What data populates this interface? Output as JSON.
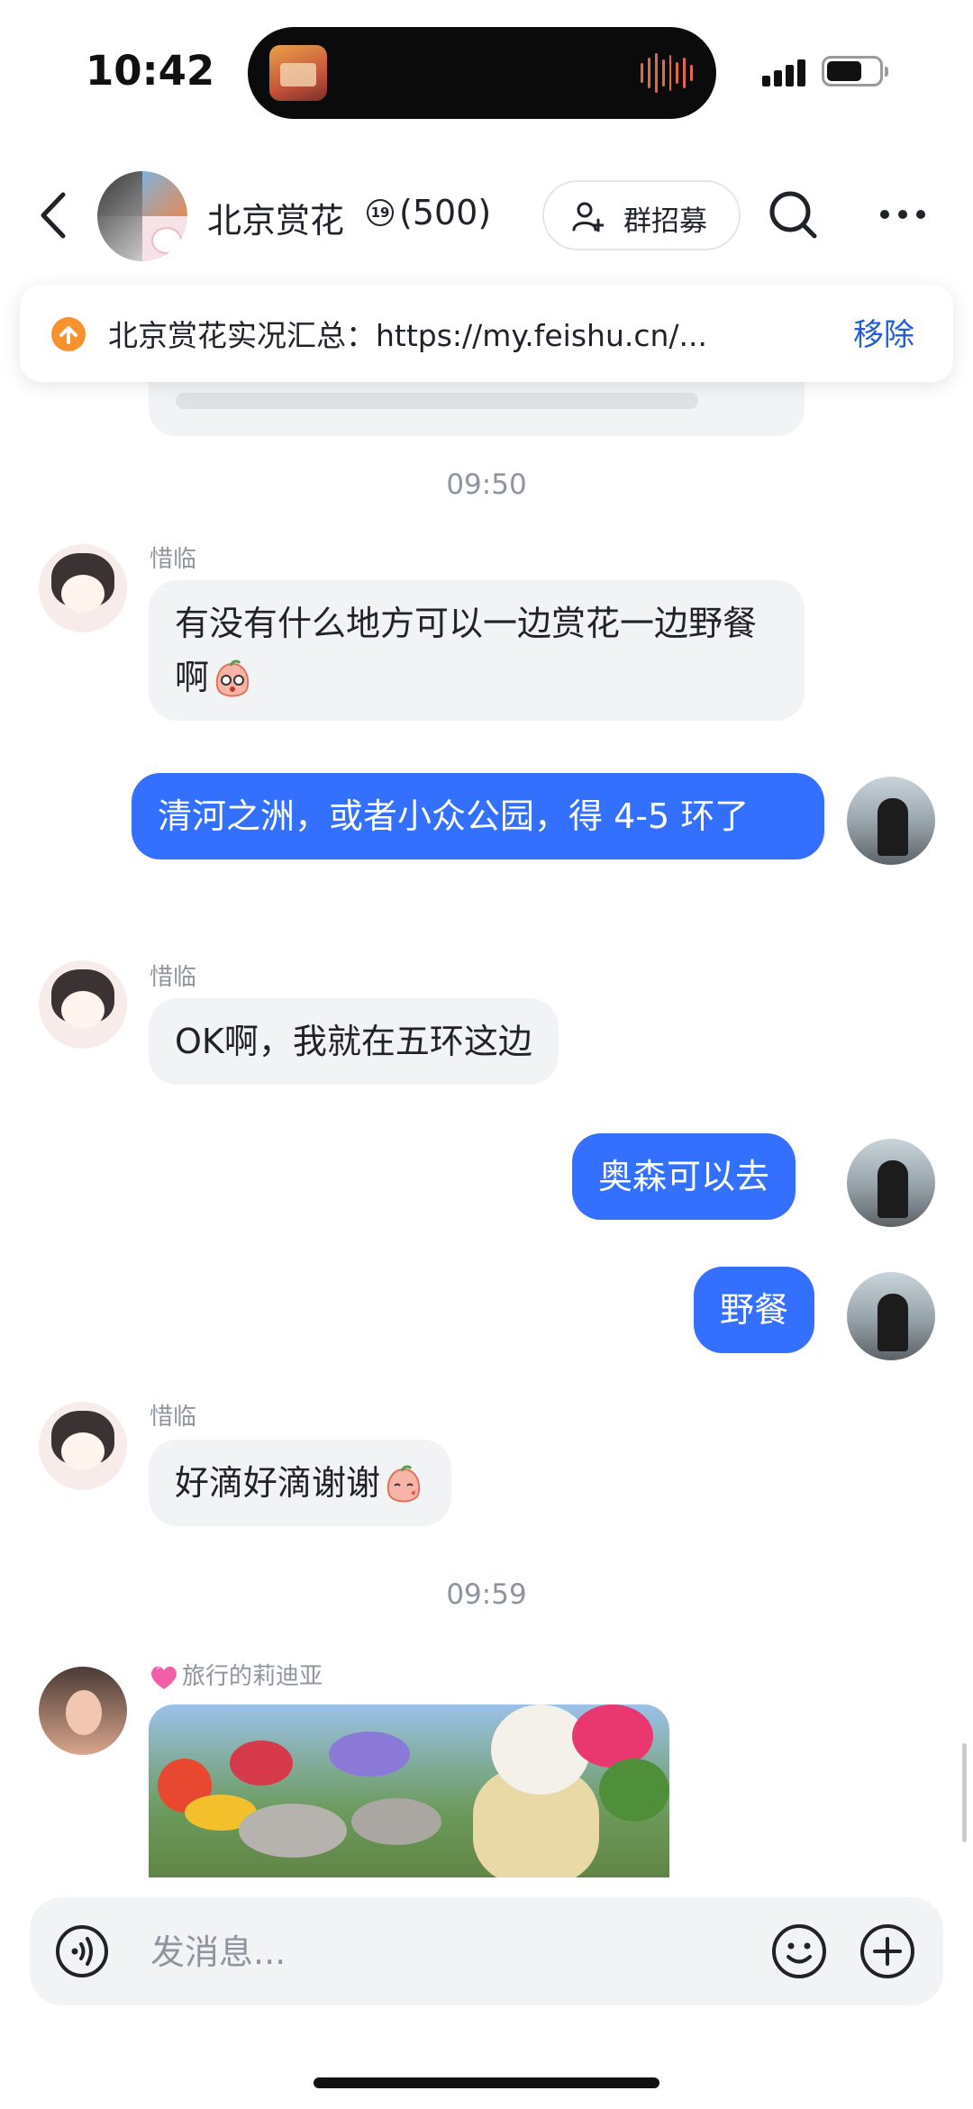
{
  "status_bar": {
    "time": "10:42"
  },
  "header": {
    "group_name": "北京赏花",
    "badge": "19",
    "member_count": "(500)",
    "recruit_label": "群招募"
  },
  "pinned": {
    "text": "北京赏花实况汇总：https://my.feishu.cn/...",
    "action": "移除"
  },
  "messages": {
    "time_1": "09:50",
    "m1_sender": "惜临",
    "m1_text": "有没有什么地方可以一边赏花一边野餐啊",
    "m2_text": "清河之洲，或者小众公园，得 4-5 环了",
    "m3_sender": "惜临",
    "m3_text": "OK啊，我就在五环这边",
    "m4_text": "奥森可以去",
    "m5_text": "野餐",
    "m6_sender": "惜临",
    "m6_text": "好滴好滴谢谢",
    "time_2": "09:59",
    "m7_sender": "旅行的莉迪亚"
  },
  "composer": {
    "placeholder": "发消息..."
  },
  "colors": {
    "accent": "#3370ff",
    "bubble_in": "#f2f3f5",
    "pin_icon": "#f7922f",
    "link": "#245bdb"
  },
  "icons": [
    "back-arrow-icon",
    "verified-icon",
    "add-person-icon",
    "search-icon",
    "more-icon",
    "pin-upload-icon",
    "voice-icon",
    "emoji-icon",
    "plus-icon"
  ]
}
